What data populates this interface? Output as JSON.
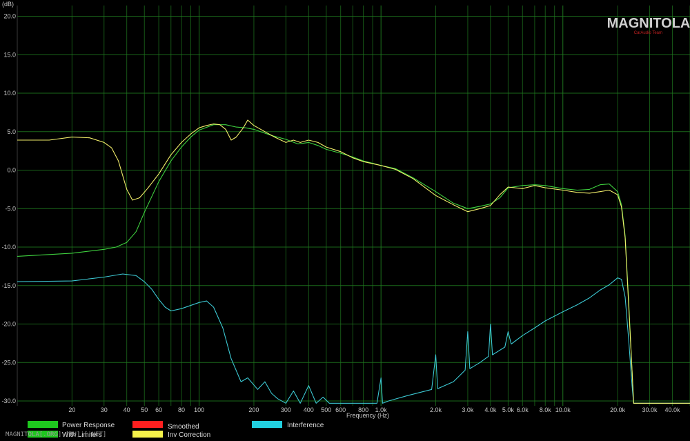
{
  "chart_data": {
    "type": "line",
    "y_unit": "(dB)",
    "xlabel": "Frequency (Hz)",
    "x_scale": "log",
    "xlim": [
      10,
      50000
    ],
    "ylim": [
      -30.5,
      21
    ],
    "grid": true,
    "y_ticks": [
      {
        "v": 20,
        "label": "20.0"
      },
      {
        "v": 15,
        "label": "15.0"
      },
      {
        "v": 10,
        "label": "10.0"
      },
      {
        "v": 5,
        "label": "5.0"
      },
      {
        "v": 0,
        "label": "0.0"
      },
      {
        "v": -5,
        "label": "-5.0"
      },
      {
        "v": -10,
        "label": "-10.0"
      },
      {
        "v": -15,
        "label": "-15.0"
      },
      {
        "v": -20,
        "label": "-20.0"
      },
      {
        "v": -25,
        "label": "-25.0"
      },
      {
        "v": -30,
        "label": "-30.0"
      }
    ],
    "x_ticks": [
      {
        "v": 20,
        "label": "20"
      },
      {
        "v": 30,
        "label": "30"
      },
      {
        "v": 40,
        "label": "40"
      },
      {
        "v": 50,
        "label": "50"
      },
      {
        "v": 60,
        "label": "60"
      },
      {
        "v": 80,
        "label": "80"
      },
      {
        "v": 100,
        "label": "100"
      },
      {
        "v": 200,
        "label": "200"
      },
      {
        "v": 300,
        "label": "300"
      },
      {
        "v": 400,
        "label": "400"
      },
      {
        "v": 500,
        "label": "500"
      },
      {
        "v": 600,
        "label": "600"
      },
      {
        "v": 800,
        "label": "800"
      },
      {
        "v": 1000,
        "label": "1.0k"
      },
      {
        "v": 2000,
        "label": "2.0k"
      },
      {
        "v": 3000,
        "label": "3.0k"
      },
      {
        "v": 4000,
        "label": "4.0k"
      },
      {
        "v": 5000,
        "label": "5.0k"
      },
      {
        "v": 6000,
        "label": "6.0k"
      },
      {
        "v": 8000,
        "label": "8.0k"
      },
      {
        "v": 10000,
        "label": "10.0k"
      },
      {
        "v": 20000,
        "label": "20.0k"
      },
      {
        "v": 30000,
        "label": "30.0k"
      },
      {
        "v": 40000,
        "label": "40.0k"
      }
    ],
    "series": [
      {
        "name": "Power Response",
        "color": "#3fd23f",
        "points": [
          [
            10,
            -11.2
          ],
          [
            20,
            -10.8
          ],
          [
            30,
            -10.3
          ],
          [
            35,
            -10.0
          ],
          [
            40,
            -9.4
          ],
          [
            45,
            -8.0
          ],
          [
            50,
            -5.5
          ],
          [
            60,
            -1.5
          ],
          [
            70,
            1.2
          ],
          [
            80,
            3.0
          ],
          [
            90,
            4.3
          ],
          [
            100,
            5.2
          ],
          [
            120,
            5.9
          ],
          [
            140,
            5.9
          ],
          [
            160,
            5.6
          ],
          [
            180,
            5.5
          ],
          [
            200,
            5.3
          ],
          [
            250,
            4.5
          ],
          [
            300,
            4.0
          ],
          [
            350,
            3.4
          ],
          [
            400,
            3.6
          ],
          [
            450,
            3.2
          ],
          [
            500,
            2.7
          ],
          [
            600,
            2.2
          ],
          [
            700,
            1.7
          ],
          [
            800,
            1.2
          ],
          [
            900,
            0.9
          ],
          [
            1000,
            0.6
          ],
          [
            1200,
            0.2
          ],
          [
            1500,
            -1.0
          ],
          [
            2000,
            -2.8
          ],
          [
            2500,
            -4.3
          ],
          [
            3000,
            -5.0
          ],
          [
            3500,
            -4.7
          ],
          [
            4000,
            -4.4
          ],
          [
            4500,
            -3.6
          ],
          [
            5000,
            -2.3
          ],
          [
            6000,
            -2.0
          ],
          [
            7000,
            -1.9
          ],
          [
            8000,
            -2.0
          ],
          [
            10000,
            -2.4
          ],
          [
            12000,
            -2.6
          ],
          [
            14000,
            -2.5
          ],
          [
            16000,
            -1.9
          ],
          [
            18000,
            -1.8
          ],
          [
            20000,
            -2.8
          ],
          [
            21000,
            -4.5
          ],
          [
            22000,
            -8.5
          ],
          [
            23000,
            -17
          ],
          [
            24000,
            -26
          ],
          [
            24500,
            -30.3
          ],
          [
            50000,
            -30.3
          ]
        ]
      },
      {
        "name": "Smoothed",
        "color": "#ff2020",
        "points": []
      },
      {
        "name": "Interference",
        "color": "#3cc8d2",
        "points": [
          [
            10,
            -14.5
          ],
          [
            20,
            -14.4
          ],
          [
            30,
            -13.9
          ],
          [
            38,
            -13.5
          ],
          [
            45,
            -13.7
          ],
          [
            50,
            -14.5
          ],
          [
            55,
            -15.5
          ],
          [
            60,
            -16.8
          ],
          [
            65,
            -17.8
          ],
          [
            70,
            -18.3
          ],
          [
            80,
            -18.0
          ],
          [
            100,
            -17.2
          ],
          [
            110,
            -17.0
          ],
          [
            120,
            -17.8
          ],
          [
            135,
            -20.5
          ],
          [
            150,
            -24.5
          ],
          [
            170,
            -27.5
          ],
          [
            185,
            -27.0
          ],
          [
            210,
            -28.5
          ],
          [
            230,
            -27.5
          ],
          [
            250,
            -29.0
          ],
          [
            270,
            -29.7
          ],
          [
            300,
            -30.3
          ],
          [
            330,
            -28.7
          ],
          [
            360,
            -30.3
          ],
          [
            400,
            -28.0
          ],
          [
            440,
            -30.3
          ],
          [
            480,
            -29.5
          ],
          [
            520,
            -30.3
          ],
          [
            600,
            -30.3
          ],
          [
            800,
            -30.3
          ],
          [
            950,
            -30.3
          ],
          [
            1000,
            -27.0
          ],
          [
            1020,
            -30.3
          ],
          [
            1100,
            -30.0
          ],
          [
            1400,
            -29.3
          ],
          [
            1900,
            -28.5
          ],
          [
            2000,
            -24.0
          ],
          [
            2050,
            -28.4
          ],
          [
            2500,
            -27.5
          ],
          [
            2900,
            -26.0
          ],
          [
            3000,
            -21.0
          ],
          [
            3080,
            -25.8
          ],
          [
            3500,
            -25.0
          ],
          [
            3900,
            -24.2
          ],
          [
            4000,
            -20.0
          ],
          [
            4100,
            -24.0
          ],
          [
            4800,
            -23.0
          ],
          [
            5000,
            -21.0
          ],
          [
            5200,
            -22.6
          ],
          [
            6000,
            -21.5
          ],
          [
            7000,
            -20.5
          ],
          [
            8000,
            -19.6
          ],
          [
            10000,
            -18.4
          ],
          [
            12000,
            -17.5
          ],
          [
            14000,
            -16.6
          ],
          [
            16000,
            -15.6
          ],
          [
            18000,
            -14.9
          ],
          [
            20000,
            -14.0
          ],
          [
            21000,
            -14.2
          ],
          [
            22000,
            -16.5
          ],
          [
            23000,
            -22
          ],
          [
            24000,
            -28
          ],
          [
            24500,
            -30.3
          ],
          [
            50000,
            -30.3
          ]
        ]
      },
      {
        "name": "Inv Correction",
        "color": "#f2ee6a",
        "points": [
          [
            10,
            3.9
          ],
          [
            15,
            3.9
          ],
          [
            20,
            4.3
          ],
          [
            25,
            4.2
          ],
          [
            30,
            3.6
          ],
          [
            33,
            2.9
          ],
          [
            36,
            1.2
          ],
          [
            40,
            -2.5
          ],
          [
            43,
            -3.9
          ],
          [
            47,
            -3.6
          ],
          [
            52,
            -2.4
          ],
          [
            60,
            -0.5
          ],
          [
            70,
            2.0
          ],
          [
            80,
            3.6
          ],
          [
            90,
            4.7
          ],
          [
            100,
            5.5
          ],
          [
            110,
            5.8
          ],
          [
            120,
            6.0
          ],
          [
            130,
            5.9
          ],
          [
            140,
            5.3
          ],
          [
            150,
            3.9
          ],
          [
            160,
            4.3
          ],
          [
            175,
            5.5
          ],
          [
            185,
            6.5
          ],
          [
            200,
            5.8
          ],
          [
            230,
            5.0
          ],
          [
            260,
            4.3
          ],
          [
            300,
            3.6
          ],
          [
            330,
            3.9
          ],
          [
            360,
            3.6
          ],
          [
            400,
            3.9
          ],
          [
            450,
            3.6
          ],
          [
            500,
            3.0
          ],
          [
            600,
            2.4
          ],
          [
            700,
            1.6
          ],
          [
            800,
            1.1
          ],
          [
            1000,
            0.6
          ],
          [
            1200,
            0.1
          ],
          [
            1500,
            -1.1
          ],
          [
            2000,
            -3.3
          ],
          [
            2500,
            -4.5
          ],
          [
            3000,
            -5.4
          ],
          [
            3500,
            -5.0
          ],
          [
            4000,
            -4.6
          ],
          [
            4500,
            -3.2
          ],
          [
            5000,
            -2.2
          ],
          [
            6000,
            -2.4
          ],
          [
            7000,
            -2.0
          ],
          [
            8000,
            -2.3
          ],
          [
            10000,
            -2.6
          ],
          [
            12000,
            -2.9
          ],
          [
            14000,
            -3.0
          ],
          [
            16000,
            -2.8
          ],
          [
            18000,
            -2.6
          ],
          [
            20000,
            -3.2
          ],
          [
            21000,
            -4.8
          ],
          [
            22000,
            -8.8
          ],
          [
            23000,
            -17.5
          ],
          [
            24000,
            -26
          ],
          [
            24500,
            -30.3
          ],
          [
            50000,
            -30.3
          ]
        ]
      }
    ],
    "legend": [
      {
        "label": "Power Response",
        "color": "#1ec81e"
      },
      {
        "label": "Smoothed",
        "color": "#ff1f1f"
      },
      {
        "label": "Interference",
        "color": "#22d0e0"
      },
      {
        "label": "With Limiters",
        "color": "#1ec81e"
      },
      {
        "label": "Inv Correction",
        "color": "#f5f24a"
      }
    ]
  },
  "logo": {
    "main": "MAGNITOLA",
    "sub": "CarAudio Team"
  },
  "watermark": "MAGNITOLA[.ORG].[RU].[.NET]",
  "colors": {
    "background": "#000000",
    "grid": "#1f7a1f"
  }
}
